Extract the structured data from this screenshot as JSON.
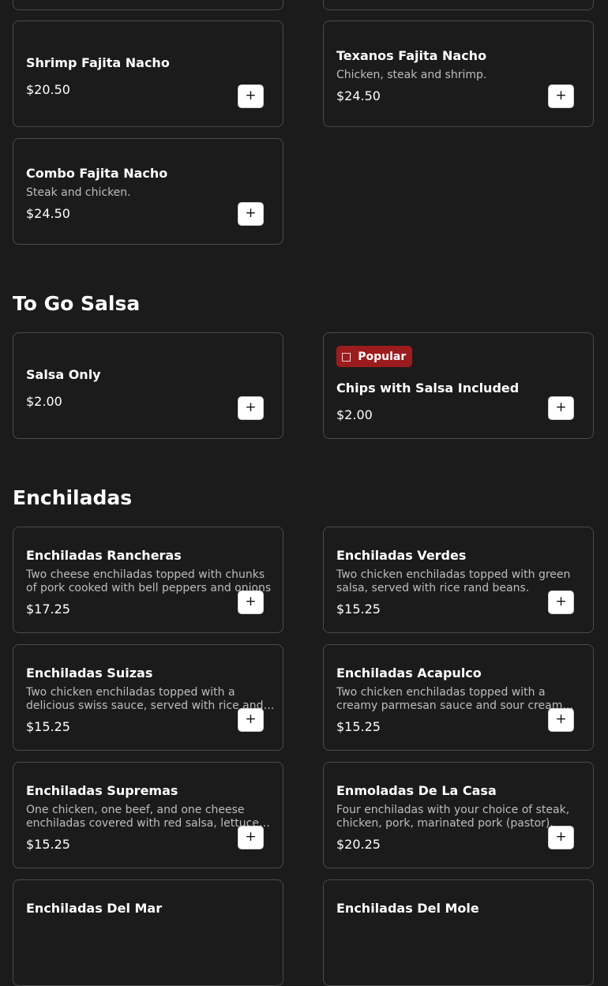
{
  "nacho_section": {
    "items": [
      {
        "name": "Shrimp Fajita Nacho",
        "description": "",
        "price": "$20.50"
      },
      {
        "name": "Texanos Fajita Nacho",
        "description": "Chicken, steak and shrimp.",
        "price": "$24.50"
      },
      {
        "name": "Combo Fajita Nacho",
        "description": "Steak and chicken.",
        "price": "$24.50"
      }
    ]
  },
  "salsa_section": {
    "title": "To Go Salsa",
    "items": [
      {
        "name": "Salsa Only",
        "description": "",
        "price": "$2.00"
      },
      {
        "name": "Chips with Salsa Included",
        "description": "",
        "price": "$2.00",
        "badge": {
          "label": "Popular",
          "icon": "fire-icon",
          "color": "#9c1c1e"
        }
      }
    ]
  },
  "enchiladas_section": {
    "title": "Enchiladas",
    "items": [
      {
        "name": "Enchiladas Rancheras",
        "description": "Two cheese enchiladas topped with chunks of pork cooked with bell peppers and onions",
        "price": "$17.25"
      },
      {
        "name": "Enchiladas Verdes",
        "description": "Two chicken enchiladas topped with green salsa, served with rice rand beans.",
        "price": "$15.25"
      },
      {
        "name": "Enchiladas Suizas",
        "description": "Two chicken enchiladas topped with a delicious swiss sauce, served with rice and beans",
        "price": "$15.25"
      },
      {
        "name": "Enchiladas Acapulco",
        "description": "Two chicken enchiladas topped with a creamy parmesan sauce and sour cream sauce",
        "price": "$15.25"
      },
      {
        "name": "Enchiladas Supremas",
        "description": "One chicken, one beef, and one cheese enchiladas covered with red salsa, lettuce and tomatoes",
        "price": "$15.25"
      },
      {
        "name": "Enmoladas De La Casa",
        "description": "Four enchiladas with your choice of steak, chicken, pork, marinated pork (pastor).",
        "price": "$20.25"
      },
      {
        "name": "Enchiladas Del Mar",
        "description": "",
        "price": ""
      },
      {
        "name": "Enchiladas Del Mole",
        "description": "",
        "price": ""
      }
    ]
  },
  "add_button_label": "+"
}
